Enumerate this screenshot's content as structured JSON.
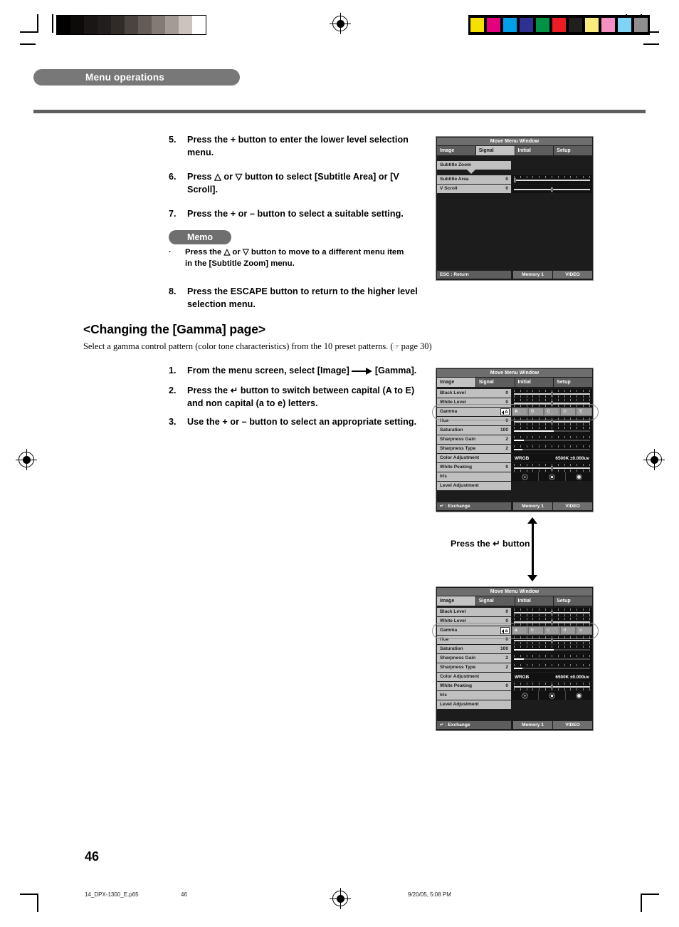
{
  "header": {
    "section_tag": "Menu operations"
  },
  "steps_top": [
    {
      "num": "5.",
      "text": "Press the + button to enter the lower level selection menu."
    },
    {
      "num": "6.",
      "text": "Press △ or ▽ button to select [Subtitle Area] or [V Scroll]."
    },
    {
      "num": "7.",
      "text": "Press the + or – button to select a suitable setting."
    }
  ],
  "memo": {
    "title": "Memo",
    "bullet": "·",
    "text": "Press the △ or ▽ button to move to a different menu item in the [Subtitle Zoom] menu."
  },
  "step_8": {
    "num": "8.",
    "text": "Press the ESCAPE button to return to the higher level selection menu."
  },
  "gamma_section": {
    "heading": "<Changing the [Gamma] page>",
    "lead_before": "Select a gamma control pattern (color tone characteristics) from the 10 preset patterns. (",
    "hand_icon": "☞",
    "lead_after": " page 30)",
    "steps": [
      {
        "num": "1.",
        "text_a": "From the menu screen, select [Image]",
        "text_b": "[Gamma]."
      },
      {
        "num": "2.",
        "text": "Press the ↵ button to switch between capital (A to E) and non capital (a to e) letters."
      },
      {
        "num": "3.",
        "text": "Use the + or – button to select an appropriate setting."
      }
    ]
  },
  "press_button_note": "Press the ↵ button",
  "osd_common": {
    "title": "Move Menu Window",
    "tabs": [
      "Image",
      "Signal",
      "Initial",
      "Setup"
    ],
    "footer_memory": "Memory 1",
    "footer_source": "VIDEO"
  },
  "osd_subtitle": {
    "active_tab": "Signal",
    "submenu_label": "Subtitle Zoom",
    "rows": [
      {
        "label": "Subtitle Area",
        "value": "0",
        "knob_pct": 2
      },
      {
        "label": "V Scroll",
        "value": "0",
        "knob_pct": 50
      }
    ],
    "footer_left": "ESC : Return"
  },
  "osd_gamma_upper": {
    "active_tab": "Image",
    "footer_left": "↵ : Exchange",
    "gamma_value": "A",
    "gamma_chips": [
      "A",
      "B",
      "C",
      "D",
      "E"
    ],
    "selected_chip": "A",
    "rows": [
      {
        "label": "Black Level",
        "value": "0",
        "type": "slider",
        "knob_pct": 50
      },
      {
        "label": "White Level",
        "value": "0",
        "type": "slider",
        "knob_pct": 50
      },
      {
        "label": "Gamma",
        "value": "A",
        "type": "chips"
      },
      {
        "label": "Hue",
        "value": "0",
        "type": "slider",
        "knob_pct": 50
      },
      {
        "label": "Saturation",
        "value": "100",
        "type": "fill",
        "fill_pct": 52
      },
      {
        "label": "Sharpness Gain",
        "value": "2",
        "type": "fill",
        "fill_pct": 13
      },
      {
        "label": "Sharpness Type",
        "value": "2",
        "type": "fill",
        "fill_pct": 11
      },
      {
        "label": "Color Adjustment",
        "value": "",
        "type": "cadj",
        "mode": "WRGB",
        "temp": "6500K ±0.000uv"
      },
      {
        "label": "White Peaking",
        "value": "0",
        "type": "slider",
        "knob_pct": 50
      },
      {
        "label": "Iris",
        "value": "",
        "type": "iris"
      },
      {
        "label": "Level Adjustment",
        "value": "",
        "type": "blank"
      }
    ]
  },
  "osd_gamma_lower": {
    "active_tab": "Image",
    "footer_left": "↵ : Exchange",
    "gamma_value": "a",
    "gamma_chips": [
      "a",
      "b",
      "c",
      "d",
      "e"
    ],
    "selected_chip": "a",
    "rows": [
      {
        "label": "Black Level",
        "value": "0",
        "type": "slider",
        "knob_pct": 50
      },
      {
        "label": "White Level",
        "value": "0",
        "type": "slider",
        "knob_pct": 50
      },
      {
        "label": "Gamma",
        "value": "a",
        "type": "chips"
      },
      {
        "label": "Hue",
        "value": "0",
        "type": "slider",
        "knob_pct": 50
      },
      {
        "label": "Saturation",
        "value": "100",
        "type": "fill",
        "fill_pct": 52
      },
      {
        "label": "Sharpness Gain",
        "value": "2",
        "type": "fill",
        "fill_pct": 13
      },
      {
        "label": "Sharpness Type",
        "value": "2",
        "type": "fill",
        "fill_pct": 11
      },
      {
        "label": "Color Adjustment",
        "value": "",
        "type": "cadj",
        "mode": "WRGB",
        "temp": "6500K ±0.000uv"
      },
      {
        "label": "White Peaking",
        "value": "0",
        "type": "slider",
        "knob_pct": 50
      },
      {
        "label": "Iris",
        "value": "",
        "type": "iris"
      },
      {
        "label": "Level Adjustment",
        "value": "",
        "type": "blank"
      }
    ]
  },
  "footer": {
    "page_number": "46",
    "file_name": "14_DPX-1300_E.p65",
    "sheet_number": "46",
    "timestamp": "9/20/05, 5:08 PM"
  },
  "calibration": {
    "gray_steps": [
      "#000000",
      "#0d0a0a",
      "#1a1616",
      "#231e1e",
      "#312b28",
      "#4b4340",
      "#645a57",
      "#837a76",
      "#a49a96",
      "#ccc3bf",
      "#ffffff"
    ],
    "color_bars": [
      "#f5e000",
      "#e5007f",
      "#00a0e9",
      "#2e3192",
      "#009245",
      "#ed1c24",
      "#211e1e",
      "#faeb7d",
      "#f490c2",
      "#7fd4f5",
      "#8e8e8e"
    ]
  }
}
